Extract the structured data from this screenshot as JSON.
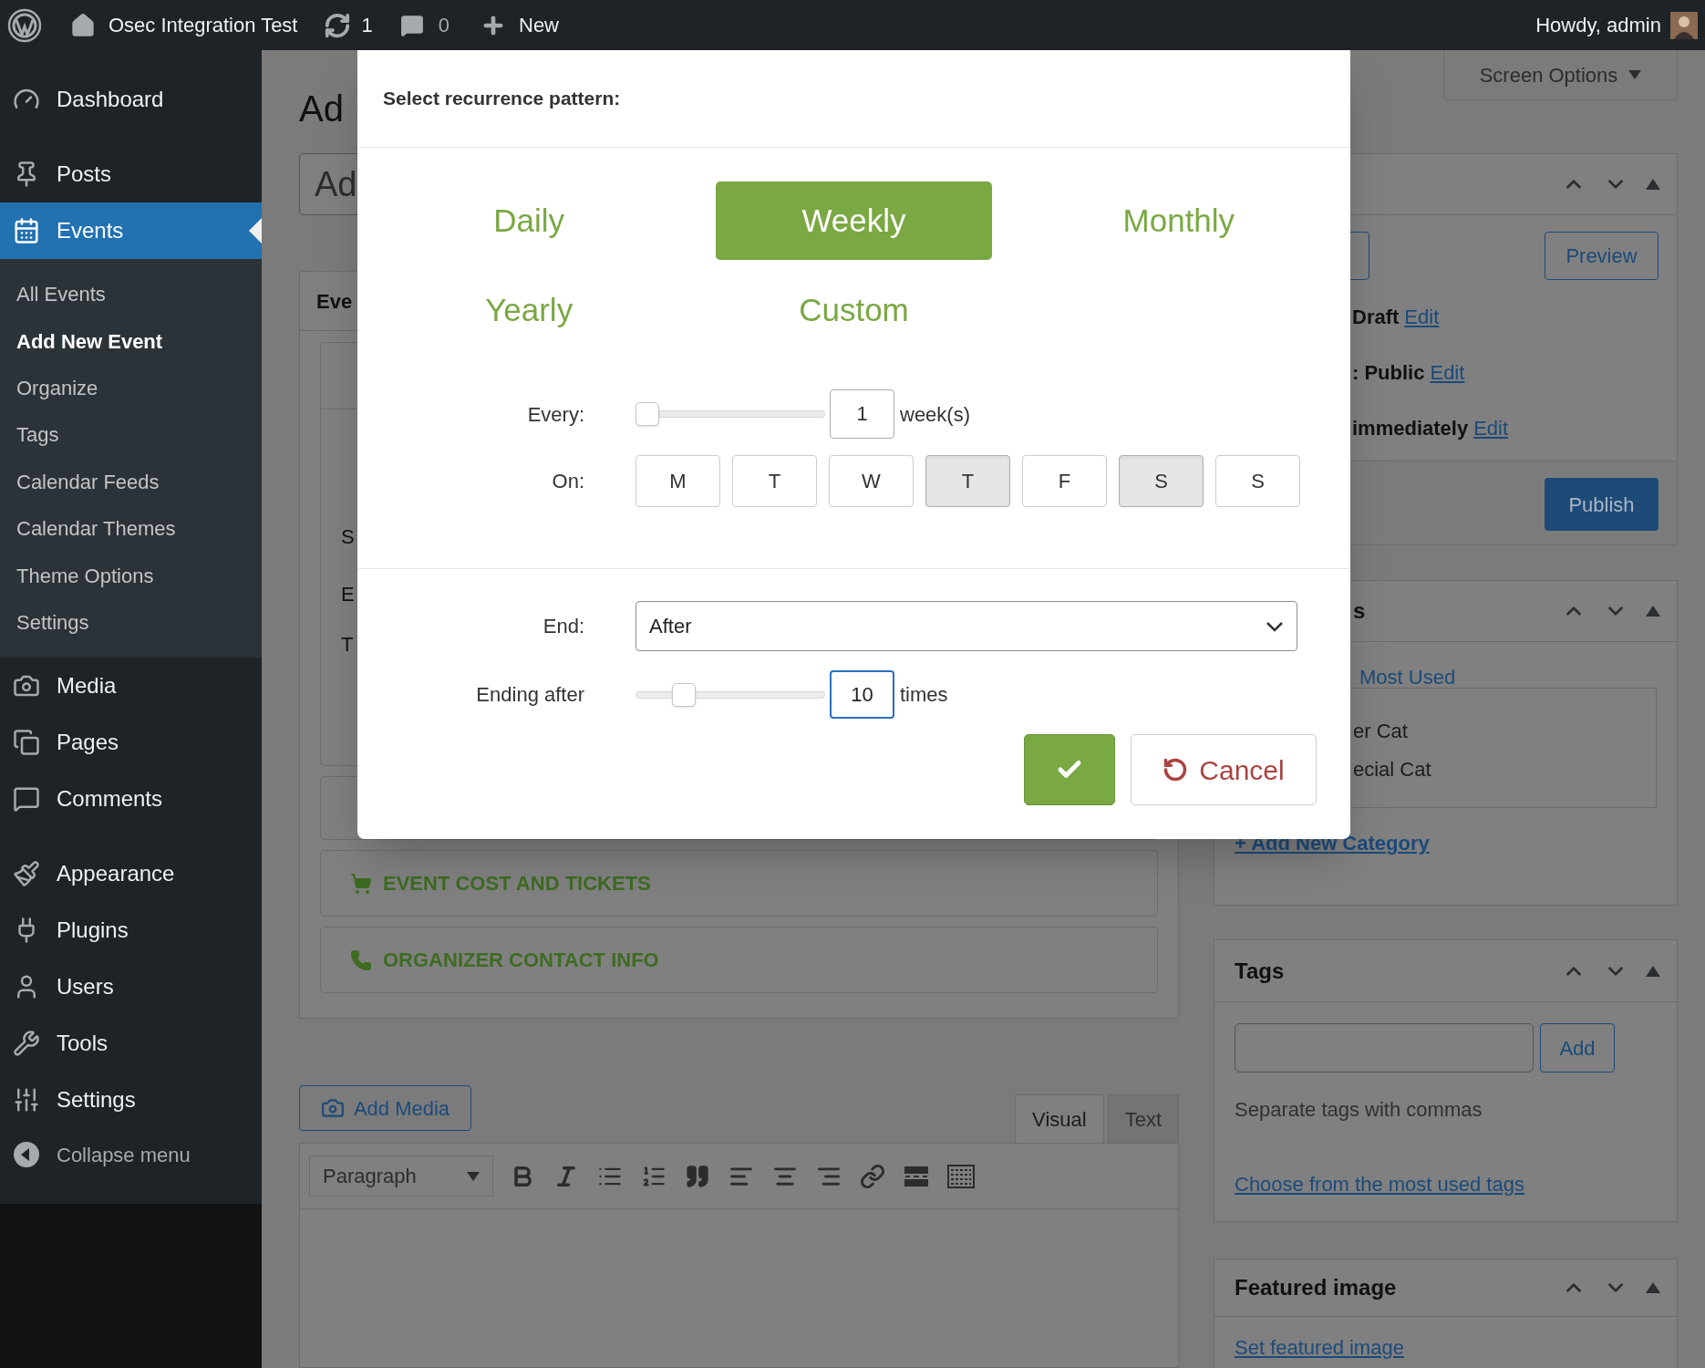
{
  "admin_bar": {
    "site_name": "Osec Integration Test",
    "updates": "1",
    "comments": "0",
    "new": "New",
    "greeting": "Howdy, admin"
  },
  "sidebar": {
    "items": [
      {
        "label": "Dashboard",
        "selected": false
      },
      {
        "label": "Posts",
        "selected": false
      },
      {
        "label": "Events",
        "selected": true,
        "children": [
          {
            "label": "All Events",
            "selected": false
          },
          {
            "label": "Add New Event",
            "selected": true
          },
          {
            "label": "Organize",
            "selected": false
          },
          {
            "label": "Tags",
            "selected": false
          },
          {
            "label": "Calendar Feeds",
            "selected": false
          },
          {
            "label": "Calendar Themes",
            "selected": false
          },
          {
            "label": "Theme Options",
            "selected": false
          },
          {
            "label": "Settings",
            "selected": false
          }
        ]
      },
      {
        "label": "Media",
        "selected": false
      },
      {
        "label": "Pages",
        "selected": false
      },
      {
        "label": "Comments",
        "selected": false
      },
      {
        "label": "Appearance",
        "selected": false
      },
      {
        "label": "Plugins",
        "selected": false
      },
      {
        "label": "Users",
        "selected": false
      },
      {
        "label": "Tools",
        "selected": false
      },
      {
        "label": "Settings",
        "selected": false
      }
    ],
    "collapse": "Collapse menu"
  },
  "page": {
    "title": "Ad",
    "title_field": "Ad",
    "event_box": {
      "title": "Eve",
      "fragments": [
        "S",
        "E",
        "T"
      ],
      "sections": [
        "EVENT COST AND TICKETS",
        "ORGANIZER CONTACT INFO"
      ]
    },
    "add_media": "Add Media",
    "editor_tabs": [
      {
        "label": "Visual",
        "selected": true
      },
      {
        "label": "Text",
        "selected": false
      }
    ],
    "format": "Paragraph"
  },
  "screen_options": "Screen Options",
  "publish": {
    "preview": "Preview",
    "rows": [
      {
        "value": "Draft",
        "link": "Edit"
      },
      {
        "value": ": Public",
        "link": "Edit"
      },
      {
        "value": "immediately",
        "link": "Edit"
      }
    ],
    "button": "Publish"
  },
  "categories": {
    "title": "s",
    "tab": "Most Used",
    "items": [
      "er Cat",
      "ecial Cat"
    ],
    "add_link": "+ Add New Category"
  },
  "tags": {
    "title": "Tags",
    "button": "Add",
    "hint": "Separate tags with commas",
    "link": "Choose from the most used tags"
  },
  "featured": {
    "title": "Featured image",
    "link": "Set featured image"
  },
  "dialog": {
    "title": "Select recurrence pattern:",
    "patterns": [
      {
        "label": "Daily",
        "selected": false
      },
      {
        "label": "Weekly",
        "selected": true
      },
      {
        "label": "Monthly",
        "selected": false
      },
      {
        "label": "Yearly",
        "selected": false
      },
      {
        "label": "Custom",
        "selected": false
      }
    ],
    "every": {
      "label": "Every:",
      "level": 0,
      "value": "1",
      "unit": "week(s)"
    },
    "on": {
      "label": "On:",
      "days": [
        {
          "label": "M",
          "selected": false
        },
        {
          "label": "T",
          "selected": false
        },
        {
          "label": "W",
          "selected": false
        },
        {
          "label": "T",
          "selected": true
        },
        {
          "label": "F",
          "selected": false
        },
        {
          "label": "S",
          "selected": true
        },
        {
          "label": "S",
          "selected": false
        }
      ]
    },
    "end": {
      "label": "End:",
      "value": "After"
    },
    "ending_after": {
      "label": "Ending after",
      "level": 0.22,
      "value": "10",
      "unit": "times",
      "focused": true
    },
    "cancel": "Cancel"
  }
}
